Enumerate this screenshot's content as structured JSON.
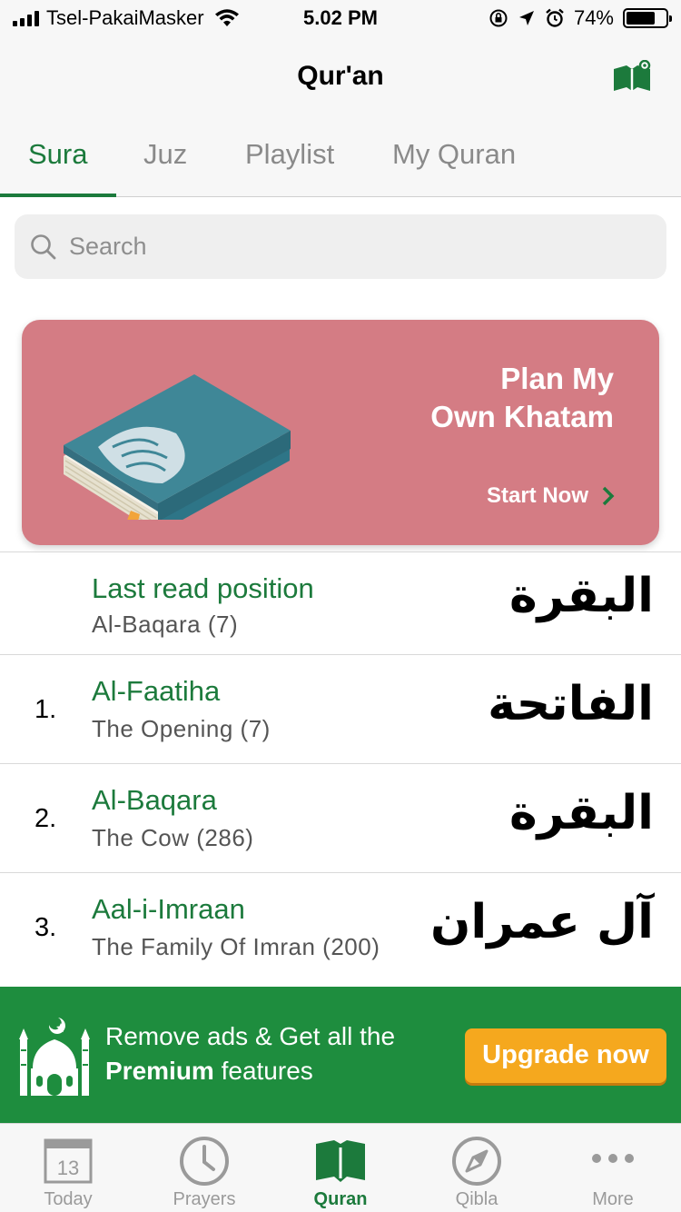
{
  "status_bar": {
    "carrier": "Tsel-PakaiMasker",
    "time": "5.02 PM",
    "battery": "74%",
    "battery_level": 0.74
  },
  "header": {
    "title": "Qur'an",
    "icon": "book-settings-icon"
  },
  "tabs": [
    {
      "label": "Sura",
      "active": true
    },
    {
      "label": "Juz",
      "active": false
    },
    {
      "label": "Playlist",
      "active": false
    },
    {
      "label": "My Quran",
      "active": false
    }
  ],
  "search": {
    "placeholder": "Search"
  },
  "banner": {
    "title_line1": "Plan My",
    "title_line2": "Own Khatam",
    "cta": "Start Now",
    "color": "#d47c84"
  },
  "last_read": {
    "title": "Last read position",
    "subtitle": "Al-Baqara (7)",
    "arabic": "البقرة"
  },
  "suras": [
    {
      "number": "1.",
      "name": "Al-Faatiha",
      "subtitle": "The Opening (7)",
      "arabic": "الفاتحة"
    },
    {
      "number": "2.",
      "name": "Al-Baqara",
      "subtitle": "The Cow (286)",
      "arabic": "البقرة"
    },
    {
      "number": "3.",
      "name": "Aal-i-Imraan",
      "subtitle": "The Family Of Imran (200)",
      "arabic": "آل عمران"
    }
  ],
  "ad": {
    "line1": "Remove ads & Get all the",
    "line2_bold": "Premium",
    "line2_rest": " features",
    "button": "Upgrade now",
    "color": "#1e8d3e",
    "button_color": "#f5a81e"
  },
  "tabbar": [
    {
      "label": "Today",
      "icon": "calendar-icon",
      "badge": "13",
      "active": false
    },
    {
      "label": "Prayers",
      "icon": "clock-icon",
      "active": false
    },
    {
      "label": "Quran",
      "icon": "book-icon",
      "active": true
    },
    {
      "label": "Qibla",
      "icon": "compass-icon",
      "active": false
    },
    {
      "label": "More",
      "icon": "more-dots-icon",
      "active": false
    }
  ],
  "colors": {
    "accent": "#1c7a3c"
  }
}
